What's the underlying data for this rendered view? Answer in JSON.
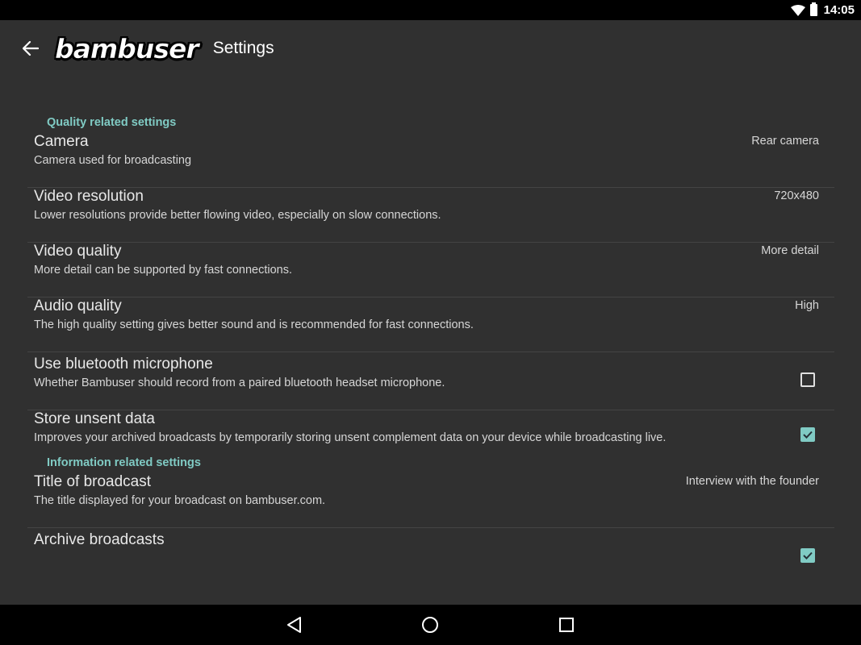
{
  "status_bar": {
    "time": "14:05",
    "icons": [
      "wifi-icon",
      "battery-icon"
    ]
  },
  "app_bar": {
    "back_icon": "arrow-left-icon",
    "logo_text": "bambuser",
    "title": "Settings"
  },
  "colors": {
    "accent": "#80cbc4",
    "background": "#303030",
    "system_bars": "#000000"
  },
  "sections": [
    {
      "header": "Quality related settings",
      "items": [
        {
          "title": "Camera",
          "summary": "Camera used for broadcasting",
          "value": "Rear camera"
        },
        {
          "title": "Video resolution",
          "summary": "Lower resolutions provide better flowing video, especially on slow connections.",
          "value": "720x480"
        },
        {
          "title": "Video quality",
          "summary": "More detail can be supported by fast connections.",
          "value": "More detail"
        },
        {
          "title": "Audio quality",
          "summary": "The high quality setting gives better sound and is recommended for fast connections.",
          "value": "High"
        },
        {
          "title": "Use bluetooth microphone",
          "summary": "Whether Bambuser should record from a paired bluetooth headset microphone.",
          "checked": false
        },
        {
          "title": "Store unsent data",
          "summary": "Improves your archived broadcasts by temporarily storing unsent complement data on your device while broadcasting live.",
          "checked": true
        }
      ]
    },
    {
      "header": "Information related settings",
      "items": [
        {
          "title": "Title of broadcast",
          "summary": "The title displayed for your broadcast on bambuser.com.",
          "value": "Interview with the founder"
        },
        {
          "title": "Archive broadcasts",
          "summary": "",
          "checked": true
        }
      ]
    }
  ],
  "nav_bar": {
    "buttons": [
      "back-triangle-icon",
      "home-circle-icon",
      "recents-square-icon"
    ]
  }
}
